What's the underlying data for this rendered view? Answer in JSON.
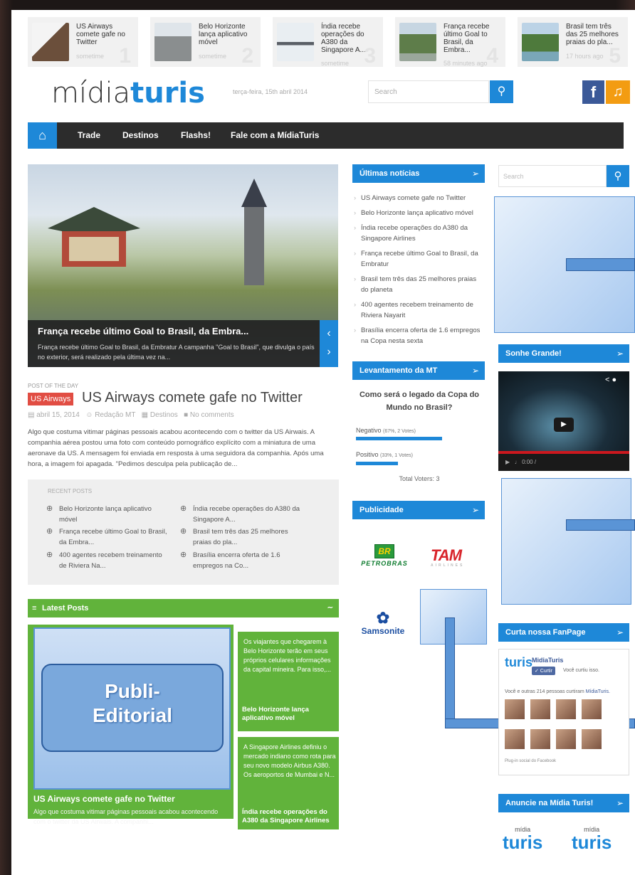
{
  "ticker": [
    {
      "title": "US Airways comete gafe no Twitter",
      "time": "sometime",
      "num": "1"
    },
    {
      "title": "Belo Horizonte lança aplicativo móvel",
      "time": "sometime",
      "num": "2"
    },
    {
      "title": "Índia recebe operações do A380 da Singapore A...",
      "time": "sometime",
      "num": "3"
    },
    {
      "title": "França recebe último Goal to Brasil, da Embra...",
      "time": "58 minutes ago",
      "num": "4"
    },
    {
      "title": "Brasil tem três das 25 melhores praias do pla...",
      "time": "17 hours ago",
      "num": "5"
    }
  ],
  "header": {
    "logo_a": "mídia",
    "logo_b": "turis",
    "date": "terça-feira, 15th abril 2014",
    "search_placeholder": "Search",
    "fb": "f"
  },
  "nav": {
    "items": [
      "Trade",
      "Destinos",
      "Flashs!",
      "Fale com a MídiaTuris"
    ]
  },
  "slider": {
    "title": "França recebe último Goal to Brasil, da Embra...",
    "desc": "França recebe último Goal to Brasil, da Embratur  A campanha \"Goal to Brasil\", que divulga o país no exterior, será realizado pela última vez na..."
  },
  "post": {
    "label": "POST OF THE DAY",
    "tag": "US Airways",
    "title": "US Airways comete gafe no Twitter",
    "date": "abril 15, 2014",
    "author": "Redação MT",
    "category": "Destinos",
    "comments": "No comments",
    "excerpt": "Algo que costuma vitimar páginas pessoais acabou acontecendo com o twitter da US Airwais. A companhia aérea postou uma foto com conteúdo pornográfico explícito com a miniatura de uma aeronave da US. A mensagem foi enviada em resposta à uma seguidora da companhia. Após uma hora, a imagem foi apagada. \"Pedimos desculpa pela publicação de..."
  },
  "recent": {
    "label": "RECENT POSTS",
    "items": [
      "Belo Horizonte lança aplicativo móvel",
      "França recebe último Goal to Brasil, da Embra...",
      "400 agentes recebem treinamento de Riviera Na...",
      "Índia recebe operações do A380 da Singapore A...",
      "Brasil tem três das 25 melhores praias do pla...",
      "Brasília encerra oferta de 1.6 empregos na Co..."
    ]
  },
  "latest": {
    "label": "Latest Posts",
    "publi": "Publi-\nEditorial",
    "main_title": "US Airways comete gafe no Twitter",
    "main_desc": "Algo que costuma vitimar páginas pessoais acabou acontecendo com o twitter da US Airwais. A companhi...",
    "card2_text": "Os viajantes que chegarem à Belo Horizonte terão em seus próprios celulares informações da capital mineira. Para isso,...",
    "card2_title": "Belo Horizonte lança aplicativo móvel",
    "card3_text": "A Singapore Airlines definiu o mercado indiano como rota para seu novo modelo Airbus A380. Os aeroportos de Mumbai e N...",
    "card3_title": "Índia recebe operações do A380 da Singapore Airlines"
  },
  "ultimas": {
    "label": "Últimas notícias",
    "items": [
      "US Airways comete gafe no Twitter",
      "Belo Horizonte lança aplicativo móvel",
      "Índia recebe operações do A380 da Singapore Airlines",
      "França recebe último Goal to Brasil, da Embratur",
      "Brasil tem três das 25 melhores praias do planeta",
      "400 agentes recebem treinamento de Riviera Nayarit",
      "Brasília encerra oferta de 1.6 empregos na Copa nesta sexta"
    ]
  },
  "poll": {
    "label": "Levantamento da MT",
    "question": "Como será o legado da Copa do Mundo no Brasil?",
    "opt1": "Negativo",
    "opt1_stats": "(67%, 2 Votes)",
    "opt1_pct": 67,
    "opt2": "Positivo",
    "opt2_stats": "(33%, 1 Votes)",
    "opt2_pct": 33,
    "total": "Total Voters: 3"
  },
  "publicidade": {
    "label": "Publicidade",
    "petro_br": "BR",
    "petro": "PETROBRAS",
    "tam": "TAM",
    "tam_sub": "AIRLINES",
    "sams": "Samsonite"
  },
  "right": {
    "search_placeholder": "Search",
    "sonhe": "Sonhe Grande!",
    "video_time": "0:00 /",
    "fanpage": "Curta nossa FanPage",
    "fb_name": "MidiaTuris",
    "fb_like": "✓ Curtir",
    "fb_liked": "Você curtiu isso.",
    "fb_text_a": "Você e outras 214 pessoas curtiram ",
    "fb_text_b": "MídiaTuris.",
    "fb_plugin": "Plug-in social do Facebook",
    "anuncie": "Anuncie na Mídia Turis!",
    "mt_small": "mídia",
    "mt_big": "turis"
  }
}
